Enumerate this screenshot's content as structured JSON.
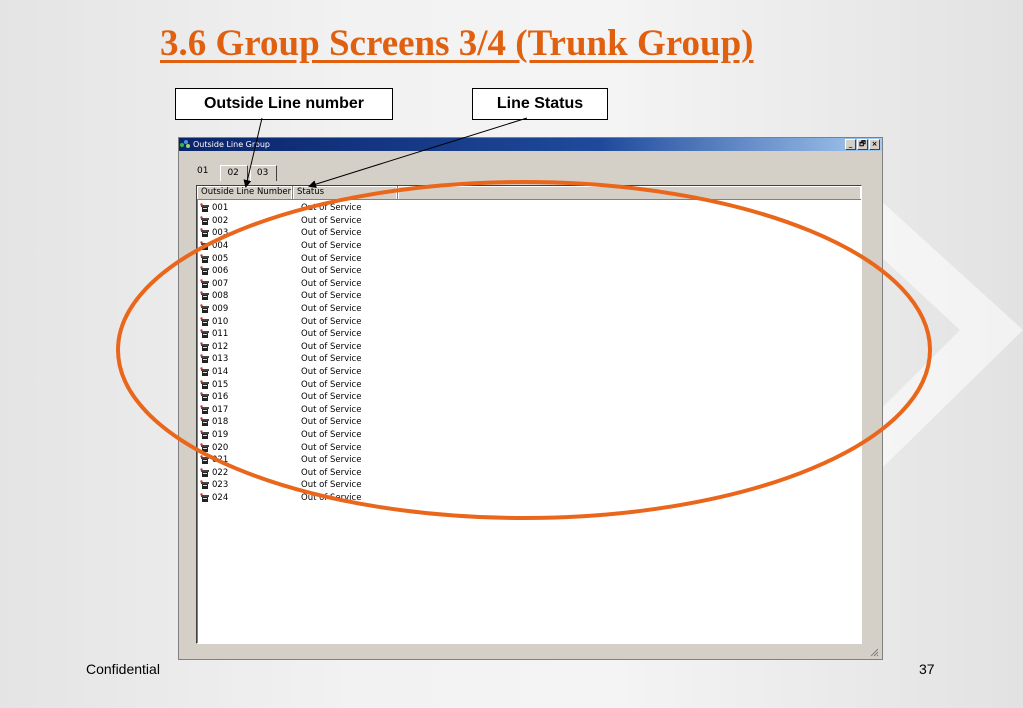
{
  "slide": {
    "title": "3.6 Group Screens 3/4 (Trunk Group)",
    "callout_outside": "Outside Line number",
    "callout_status": "Line Status",
    "footer_left": "Confidential",
    "page_number": "37",
    "accent_color": "#e9661b"
  },
  "window": {
    "title": "Outside Line Group",
    "buttons": [
      "_",
      "🗗",
      "×"
    ],
    "tabs": [
      "01",
      "02",
      "03"
    ],
    "active_tab": "01",
    "columns": [
      "Outside Line Number",
      "Status"
    ],
    "rows": [
      {
        "number": "001",
        "status": "Out of Service"
      },
      {
        "number": "002",
        "status": "Out of Service"
      },
      {
        "number": "003",
        "status": "Out of Service"
      },
      {
        "number": "004",
        "status": "Out of Service"
      },
      {
        "number": "005",
        "status": "Out of Service"
      },
      {
        "number": "006",
        "status": "Out of Service"
      },
      {
        "number": "007",
        "status": "Out of Service"
      },
      {
        "number": "008",
        "status": "Out of Service"
      },
      {
        "number": "009",
        "status": "Out of Service"
      },
      {
        "number": "010",
        "status": "Out of Service"
      },
      {
        "number": "011",
        "status": "Out of Service"
      },
      {
        "number": "012",
        "status": "Out of Service"
      },
      {
        "number": "013",
        "status": "Out of Service"
      },
      {
        "number": "014",
        "status": "Out of Service"
      },
      {
        "number": "015",
        "status": "Out of Service"
      },
      {
        "number": "016",
        "status": "Out of Service"
      },
      {
        "number": "017",
        "status": "Out of Service"
      },
      {
        "number": "018",
        "status": "Out of Service"
      },
      {
        "number": "019",
        "status": "Out of Service"
      },
      {
        "number": "020",
        "status": "Out of Service"
      },
      {
        "number": "021",
        "status": "Out of Service"
      },
      {
        "number": "022",
        "status": "Out of Service"
      },
      {
        "number": "023",
        "status": "Out of Service"
      },
      {
        "number": "024",
        "status": "Out of Service"
      }
    ]
  }
}
